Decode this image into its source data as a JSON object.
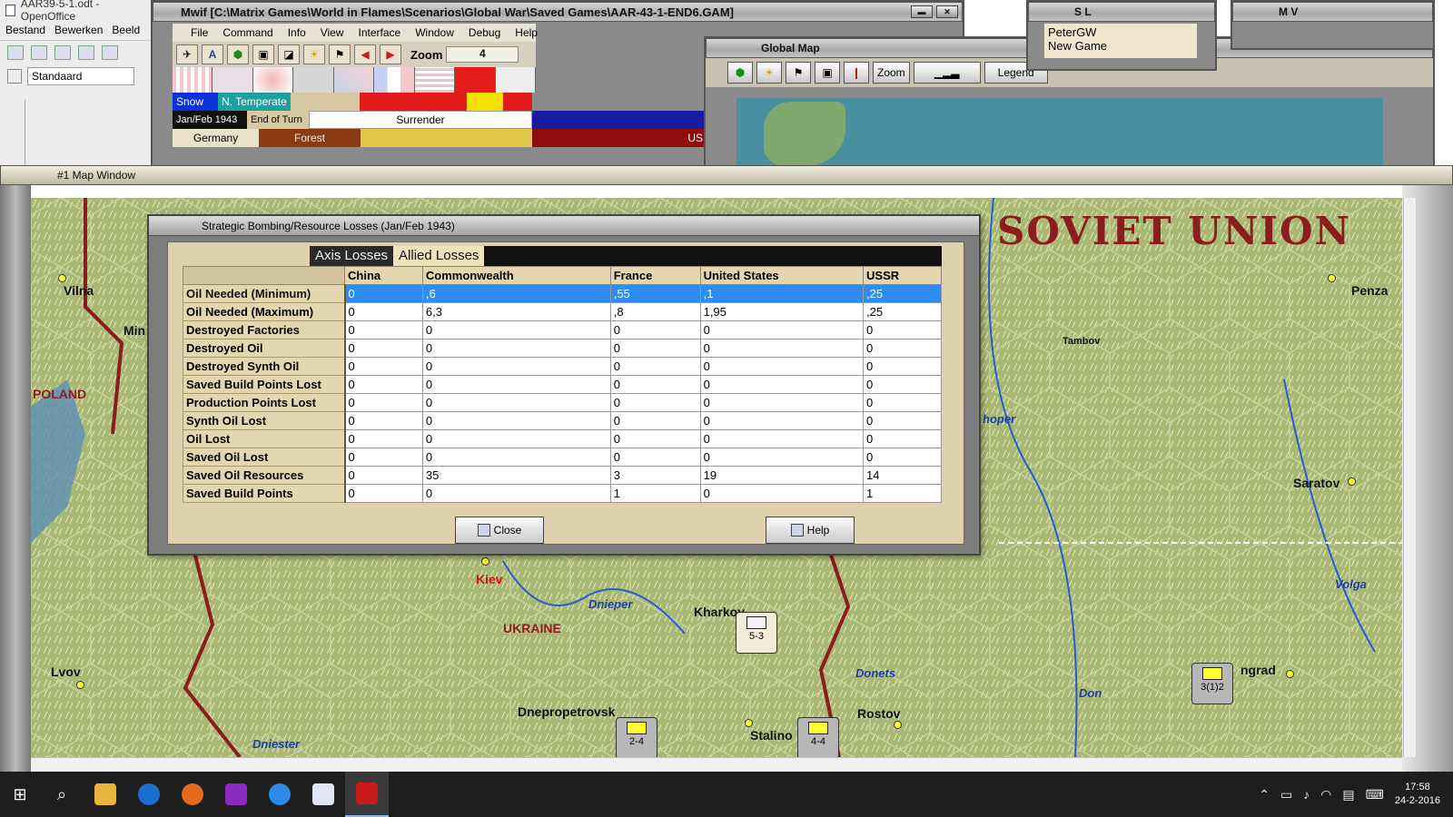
{
  "office": {
    "title": "AAR39-5-1.odt - OpenOffice",
    "menu": [
      "Bestand",
      "Bewerken",
      "Beeld"
    ],
    "style_value": "Standaard"
  },
  "mwif": {
    "title": "Mwif [C:\\Matrix Games\\World in Flames\\Scenarios\\Global War\\Saved Games\\AAR-43-1-END6.GAM]",
    "menu": [
      "File",
      "Command",
      "Info",
      "View",
      "Interface",
      "Window",
      "Debug",
      "Help"
    ],
    "zoom_label": "Zoom",
    "zoom_value": "4",
    "weather": "Snow",
    "zone": "N. Temperate",
    "date": "Jan/Feb 1943",
    "phase": "End of Turn",
    "action": "Surrender",
    "country": "Germany",
    "terrain": "Forest",
    "ussr_short": "USS"
  },
  "global_map": {
    "title": "Global Map",
    "zoom_label": "Zoom",
    "legend_label": "Legend"
  },
  "player": {
    "title": "S L",
    "name": "PeterGW",
    "status": "New Game"
  },
  "mv": {
    "title": "M V"
  },
  "map_window": {
    "title": "#1 Map Window",
    "labels": {
      "soviet_union": "SOVIET UNION",
      "poland": "POLAND",
      "ukraine": "UKRAINE",
      "vilna": "Vilna",
      "min": "Min",
      "penza": "Penza",
      "tambov": "Tambov",
      "khoper": "hoper",
      "saratov": "Saratov",
      "kiev": "Kiev",
      "dnieper": "Dnieper",
      "kharkov": "Kharkov",
      "volga": "Volga",
      "lvov": "Lvov",
      "dnepropetrovsk": "Dnepropetrovsk",
      "stalino": "Stalino",
      "rostov": "Rostov",
      "donets": "Donets",
      "don": "Don",
      "grad": "ngrad",
      "dniester": "Dniester"
    },
    "counters": {
      "kharkov_unit": "5-3",
      "dnep_unit": "2-4",
      "stalino_unit": "4-4",
      "grad_unit": "3(1)2"
    }
  },
  "dialog": {
    "title": "Strategic Bombing/Resource Losses (Jan/Feb 1943)",
    "tabs": [
      "Axis Losses",
      "Allied Losses"
    ],
    "columns": [
      "China",
      "Commonwealth",
      "France",
      "United States",
      "USSR"
    ],
    "rows": [
      {
        "label": "Oil Needed (Minimum)",
        "values": [
          "0",
          ",6",
          ",55",
          ",1",
          ",25"
        ]
      },
      {
        "label": "Oil Needed (Maximum)",
        "values": [
          "0",
          "6,3",
          ",8",
          "1,95",
          ",25"
        ]
      },
      {
        "label": "Destroyed Factories",
        "values": [
          "0",
          "0",
          "0",
          "0",
          "0"
        ]
      },
      {
        "label": "Destroyed Oil",
        "values": [
          "0",
          "0",
          "0",
          "0",
          "0"
        ]
      },
      {
        "label": "Destroyed Synth Oil",
        "values": [
          "0",
          "0",
          "0",
          "0",
          "0"
        ]
      },
      {
        "label": "Saved Build Points Lost",
        "values": [
          "0",
          "0",
          "0",
          "0",
          "0"
        ]
      },
      {
        "label": "Production Points Lost",
        "values": [
          "0",
          "0",
          "0",
          "0",
          "0"
        ]
      },
      {
        "label": "Synth Oil Lost",
        "values": [
          "0",
          "0",
          "0",
          "0",
          "0"
        ]
      },
      {
        "label": "Oil Lost",
        "values": [
          "0",
          "0",
          "0",
          "0",
          "0"
        ]
      },
      {
        "label": "Saved Oil Lost",
        "values": [
          "0",
          "0",
          "0",
          "0",
          "0"
        ]
      },
      {
        "label": "Saved Oil Resources",
        "values": [
          "0",
          "35",
          "3",
          "19",
          "14"
        ]
      },
      {
        "label": "Saved Build Points",
        "values": [
          "0",
          "0",
          "1",
          "0",
          "1"
        ]
      }
    ],
    "close_label": "Close",
    "help_label": "Help"
  },
  "taskbar": {
    "time": "17:58",
    "date": "24-2-2016"
  },
  "colors": {
    "selected_row": "#2f8cf0",
    "dialog_bg": "#ddd1ae",
    "soviet_red": "#8b1d1d",
    "snow_blue": "#0a32d8",
    "zone_teal": "#1fa0a0"
  }
}
